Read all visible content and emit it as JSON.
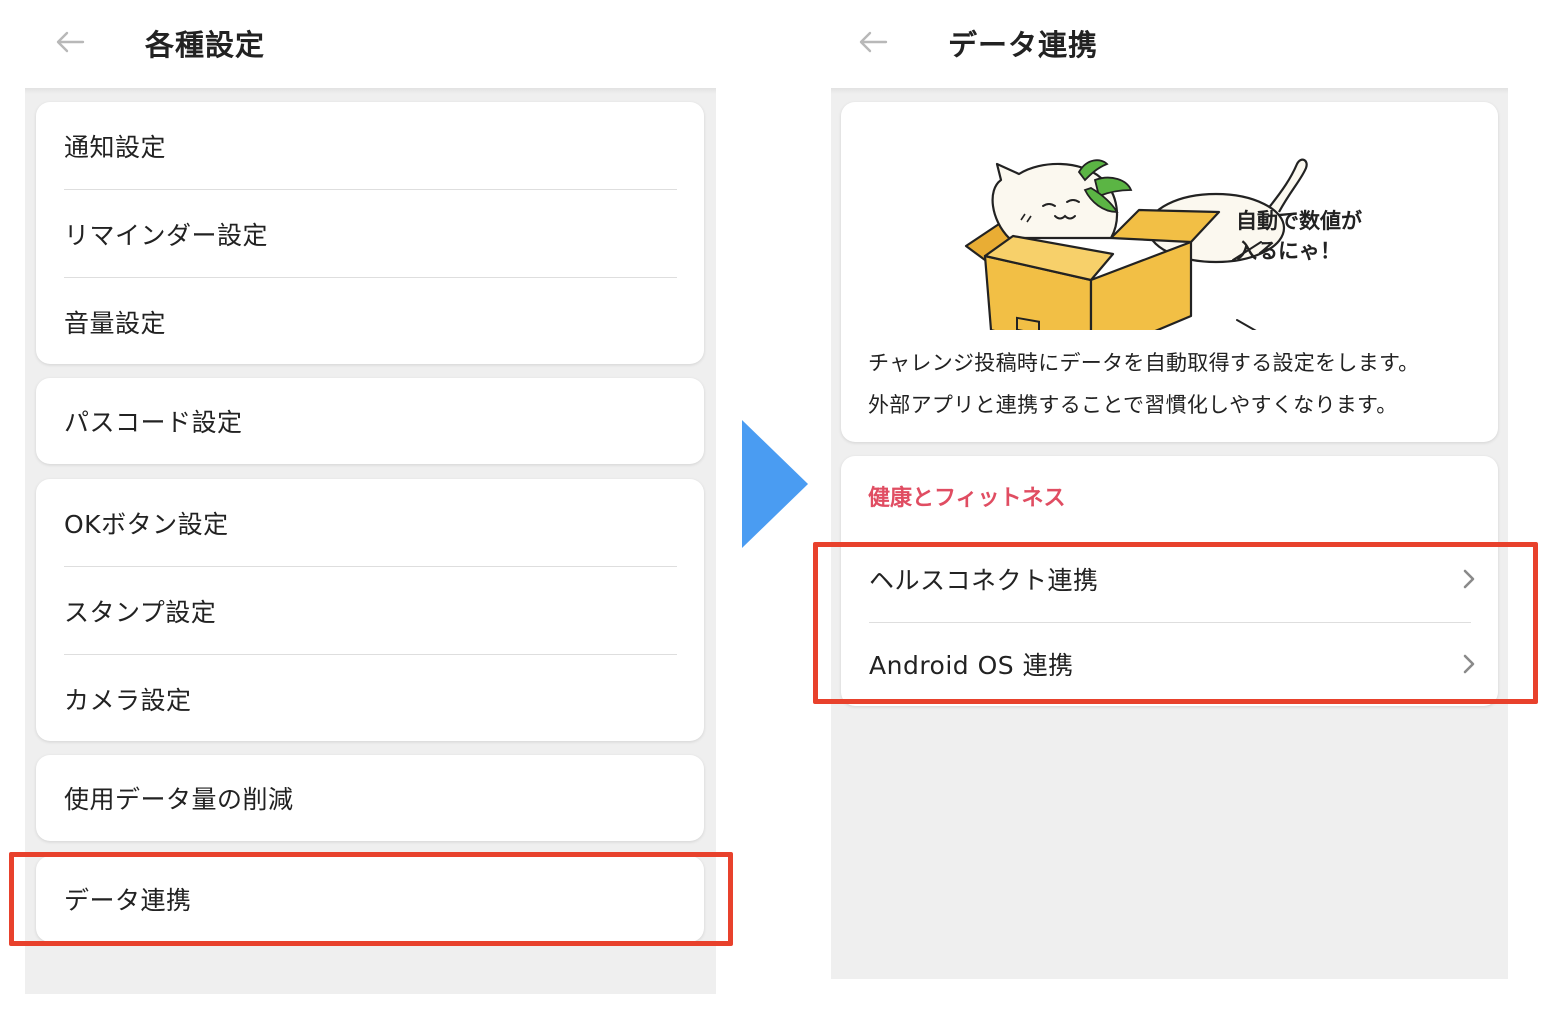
{
  "left_screen": {
    "title": "各種設定",
    "groups": [
      [
        "通知設定",
        "リマインダー設定",
        "音量設定"
      ],
      [
        "パスコード設定"
      ],
      [
        "OKボタン設定",
        "スタンプ設定",
        "カメラ設定"
      ],
      [
        "使用データ量の削減"
      ],
      [
        "データ連携"
      ]
    ]
  },
  "right_screen": {
    "title": "データ連携",
    "intro_card": {
      "bubble_line1": "自動で数値が",
      "bubble_line2": "入るにゃ！",
      "desc_line1": "チャレンジ投稿時にデータを自動取得する設定をします。",
      "desc_line2": "外部アプリと連携することで習慣化しやすくなります。"
    },
    "section": {
      "title": "健康とフィットネス",
      "items": [
        "ヘルスコネクト連携",
        "Android OS 連携"
      ]
    }
  },
  "colors": {
    "highlight": "#e8412c",
    "flow_arrow": "#4a9cf2",
    "section_title": "#e04d62",
    "box": "#f2bf45"
  }
}
